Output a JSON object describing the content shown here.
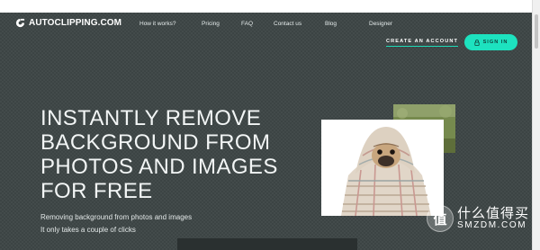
{
  "brand": {
    "logo_text": "AUTOCLIPPING.COM"
  },
  "nav": {
    "items": [
      {
        "label": "How it works?"
      },
      {
        "label": "Pricing"
      },
      {
        "label": "FAQ"
      },
      {
        "label": "Contact us"
      },
      {
        "label": "Blog"
      },
      {
        "label": "Designer"
      }
    ]
  },
  "auth": {
    "create_account_label": "CREATE AN ACCOUNT",
    "sign_in_label": "SIGN IN"
  },
  "hero": {
    "headline_lines": [
      "INSTANTLY REMOVE",
      "BACKGROUND FROM",
      "PHOTOS AND IMAGES",
      "FOR FREE"
    ],
    "subtext_lines": [
      "Removing background from photos and images",
      "It only takes a couple of clicks"
    ]
  },
  "watermark": {
    "glyph": "值",
    "cn": "什么值得买",
    "en": "SMZDM.COM"
  },
  "colors": {
    "hero_bg": "#3c4444",
    "accent": "#1de2bf",
    "text": "#f2f5f5"
  },
  "icons": {
    "logo": "autoclipping-logo-icon",
    "lock": "lock-icon"
  }
}
